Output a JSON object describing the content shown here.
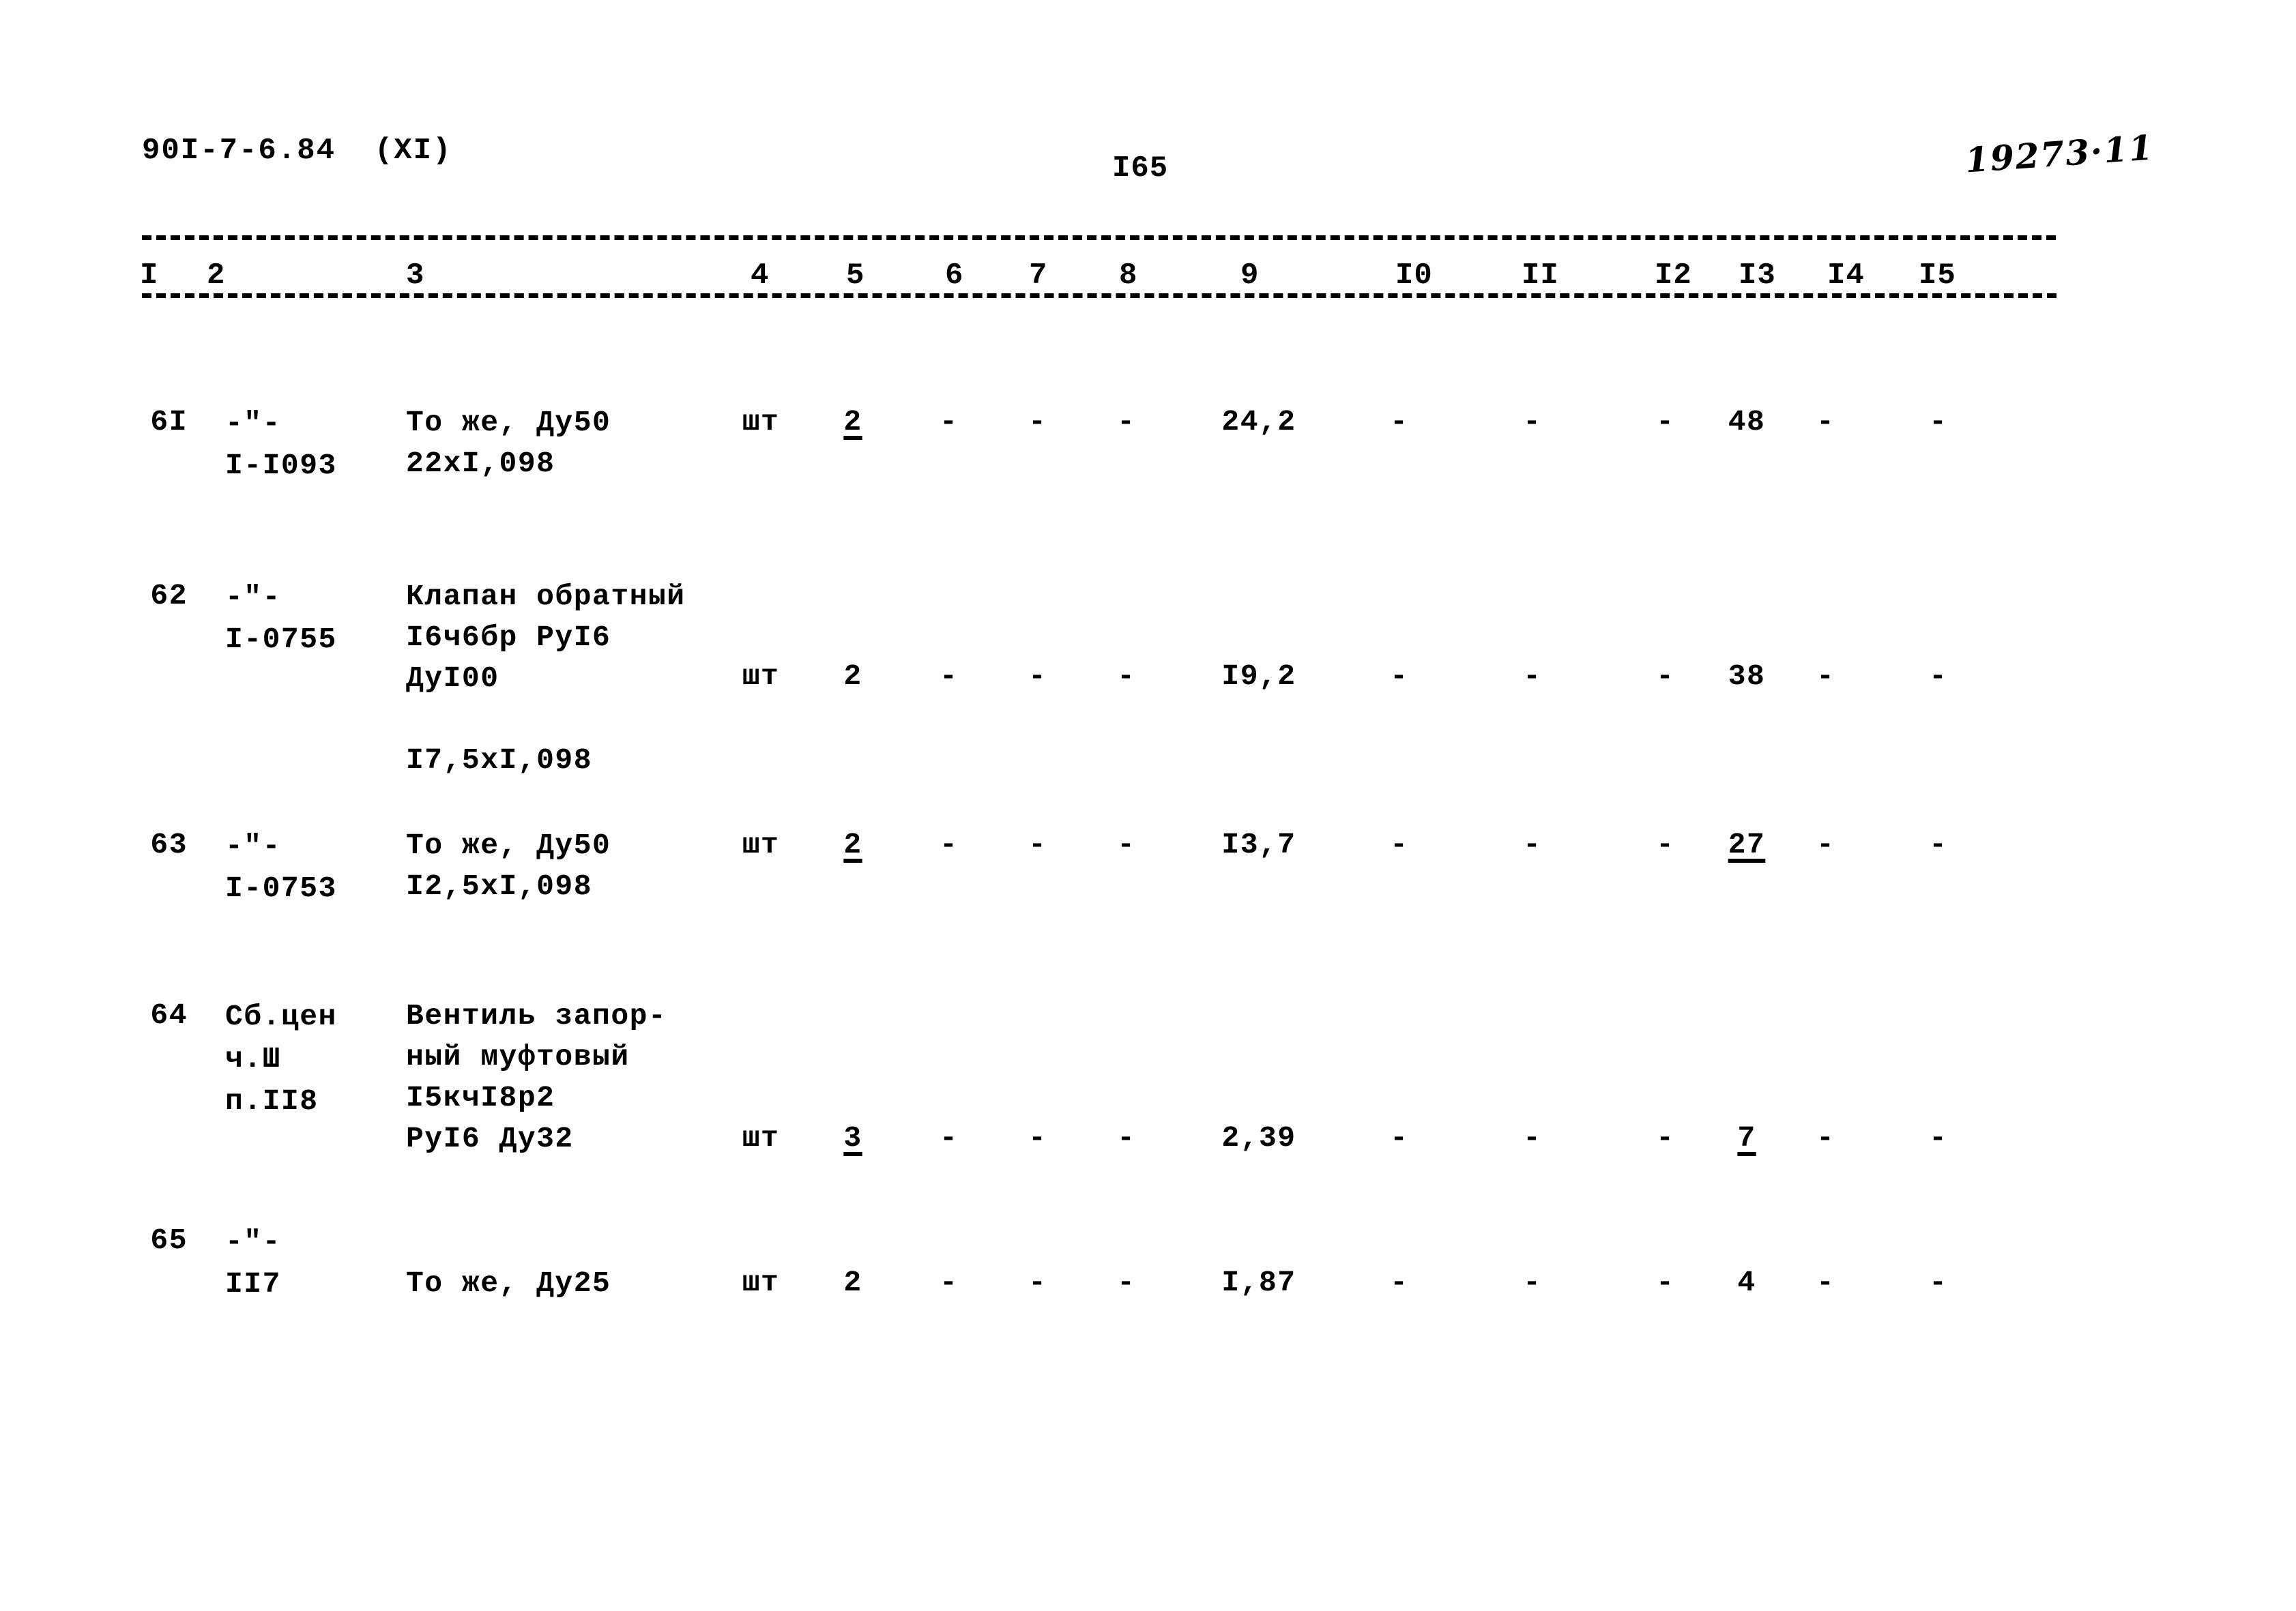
{
  "header": {
    "doc_code": "90I-7-6.84  (XI)",
    "page_number": "I65",
    "hand_note": "19273·11"
  },
  "column_numbers": [
    "I",
    "2",
    "3",
    "4",
    "5",
    "6",
    "7",
    "8",
    "9",
    "I0",
    "II",
    "I2",
    "I3",
    "I4",
    "I5"
  ],
  "rows": [
    {
      "no": "6I",
      "ref_lines": [
        "-\"-",
        "I-I093"
      ],
      "desc_lines": [
        "То же, Ду50",
        "22хI,098"
      ],
      "unit": "шт",
      "qty": "2",
      "qty_underline": true,
      "c6": "-",
      "c7": "-",
      "c8": "-",
      "c9": "24,2",
      "c10": "-",
      "c11": "-",
      "c12": "-",
      "c13": "48",
      "c13_underline": false,
      "c14": "-",
      "c15": "-"
    },
    {
      "no": "62",
      "ref_lines": [
        "-\"-",
        "I-0755"
      ],
      "desc_lines": [
        "Клапан обратный",
        "I6ч6бр РуI6",
        "ДуI00",
        "",
        "I7,5хI,098"
      ],
      "unit": "шт",
      "qty": "2",
      "qty_underline": false,
      "c6": "-",
      "c7": "-",
      "c8": "-",
      "c9": "I9,2",
      "c10": "-",
      "c11": "-",
      "c12": "-",
      "c13": "38",
      "c13_underline": false,
      "c14": "-",
      "c15": "-"
    },
    {
      "no": "63",
      "ref_lines": [
        "-\"-",
        "I-0753"
      ],
      "desc_lines": [
        "То же, Ду50",
        "I2,5хI,098"
      ],
      "unit": "шт",
      "qty": "2",
      "qty_underline": true,
      "c6": "-",
      "c7": "-",
      "c8": "-",
      "c9": "I3,7",
      "c10": "-",
      "c11": "-",
      "c12": "-",
      "c13": "27",
      "c13_underline": true,
      "c14": "-",
      "c15": "-"
    },
    {
      "no": "64",
      "ref_lines": [
        "Сб.цен",
        "ч.Ш",
        "п.II8"
      ],
      "desc_lines": [
        "Вентиль запор-",
        "ный муфтовый",
        "I5кчI8р2",
        "РуI6 Ду32"
      ],
      "unit": "шт",
      "qty": "3",
      "qty_underline": true,
      "c6": "-",
      "c7": "-",
      "c8": "-",
      "c9": "2,39",
      "c10": "-",
      "c11": "-",
      "c12": "-",
      "c13": "7",
      "c13_underline": true,
      "c14": "-",
      "c15": "-"
    },
    {
      "no": "65",
      "ref_lines": [
        "-\"-",
        "II7"
      ],
      "desc_lines": [
        "То же, Ду25"
      ],
      "unit": "шт",
      "qty": "2",
      "qty_underline": false,
      "c6": "-",
      "c7": "-",
      "c8": "-",
      "c9": "I,87",
      "c10": "-",
      "c11": "-",
      "c12": "-",
      "c13": "4",
      "c13_underline": false,
      "c14": "-",
      "c15": "-"
    }
  ]
}
